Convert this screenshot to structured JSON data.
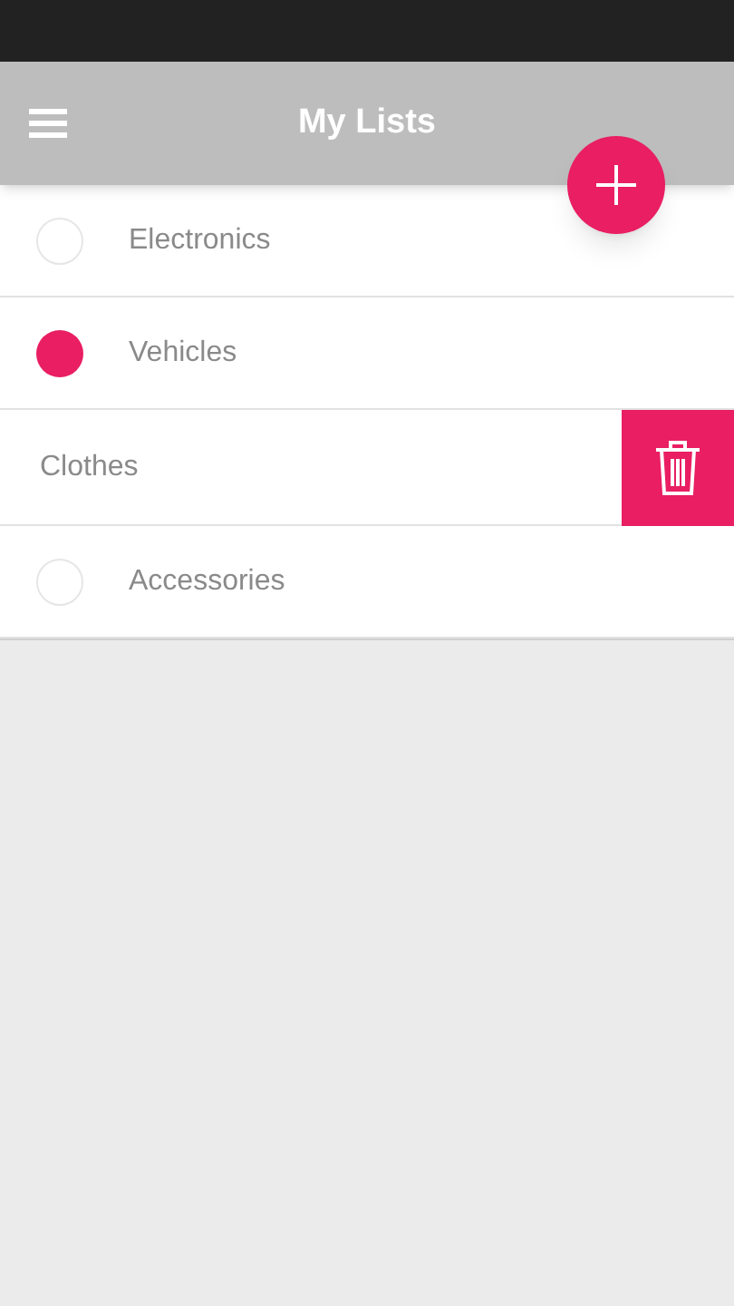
{
  "header": {
    "title": "My Lists"
  },
  "lists": [
    {
      "kind": "item",
      "label": "Electronics",
      "selected": false
    },
    {
      "kind": "item",
      "label": "Vehicles",
      "selected": true
    },
    {
      "kind": "swiped",
      "label": "Clothes"
    },
    {
      "kind": "item",
      "label": "Accessories",
      "selected": false
    }
  ]
}
